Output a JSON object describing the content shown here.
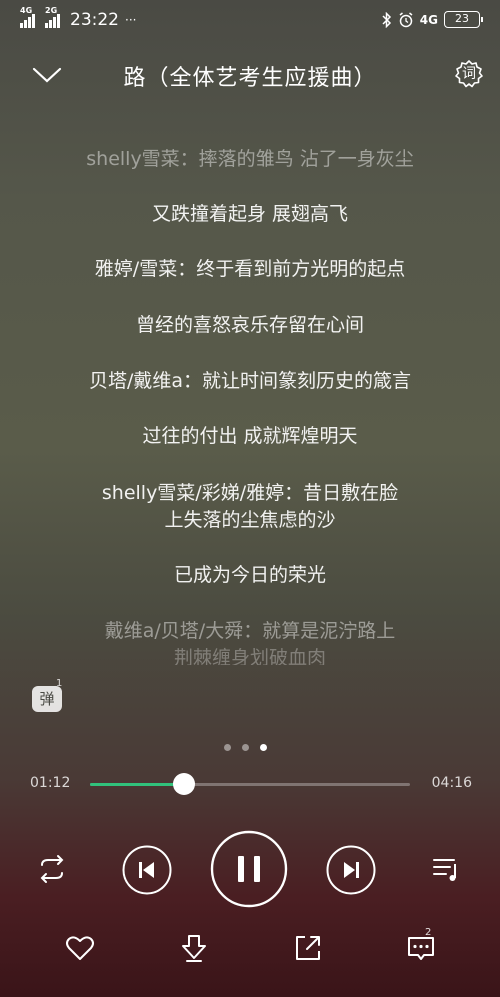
{
  "status_bar": {
    "signal1_tag": "4G",
    "signal2_tag": "2G",
    "time": "23:22",
    "more": "···",
    "network": "4G",
    "battery": "23"
  },
  "header": {
    "title": "路（全体艺考生应援曲）",
    "lyric_button": "词"
  },
  "lyrics": [
    "shelly雪菜：摔落的雏鸟 沾了一身灰尘",
    "又跌撞着起身 展翅高飞",
    "雅婷/雪菜：终于看到前方光明的起点",
    "曾经的喜怒哀乐存留在心间",
    "贝塔/戴维a：就让时间篆刻历史的箴言",
    "过往的付出 成就辉煌明天",
    "shelly雪菜/彩娣/雅婷：昔日敷在脸",
    "上失落的尘焦虑的沙",
    "已成为今日的荣光",
    "戴维a/贝塔/大舜：就算是泥泞路上",
    "荆棘缠身划破血肉"
  ],
  "danmu": {
    "label": "弹",
    "count": "1"
  },
  "pager": {
    "pages": 3,
    "active": 2
  },
  "progress": {
    "current": "01:12",
    "total": "04:16",
    "fraction": 0.295
  },
  "comments": {
    "count": "2"
  },
  "colors": {
    "accent": "#31c27c"
  },
  "icons": [
    "repeat-icon",
    "previous-icon",
    "pause-icon",
    "next-icon",
    "playlist-icon",
    "heart-icon",
    "download-icon",
    "share-icon",
    "comment-icon"
  ]
}
